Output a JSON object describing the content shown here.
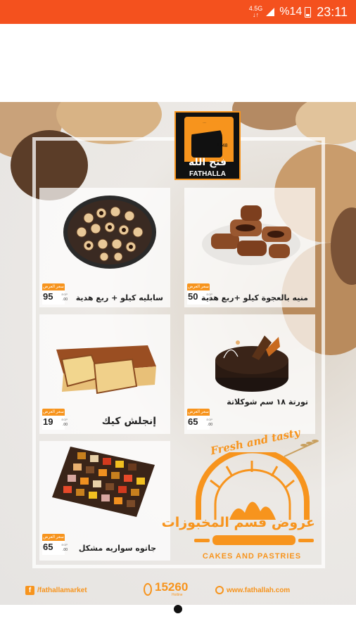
{
  "status_bar": {
    "network_top": "4.5G",
    "network_bottom": "↓↑",
    "battery_text": "%14",
    "time": "23:11"
  },
  "logo": {
    "year": "1948",
    "name_ar": "فتح الله",
    "name_en": "FATHALLA"
  },
  "products": [
    {
      "name": "منيه بالعجوة كيلو +ربع هدية",
      "price_label": "سعر العرض",
      "price": "50",
      "decimals": ".00",
      "currency": "EGP"
    },
    {
      "name": "سابليه كيلو + ربع هدية",
      "price_label": "سعر العرض",
      "price": "95",
      "decimals": ".00",
      "currency": "EGP"
    },
    {
      "name": "تورتة ١٨ سم شوكلاتة",
      "price_label": "سعر العرض",
      "price": "65",
      "decimals": ".00",
      "currency": "EGP"
    },
    {
      "name": "إنجلش كيك",
      "price_label": "سعر العرض",
      "price": "19",
      "decimals": ".00",
      "currency": "EGP"
    },
    {
      "name": "جاتوه سواريه مشكل",
      "price_label": "سعر العرض",
      "price": "65",
      "decimals": ".00",
      "currency": "EGP"
    }
  ],
  "bakery_banner": {
    "tagline": "Fresh and tasty",
    "title_ar": "عروض قسم المخبوزات",
    "subtitle_en": "CAKES AND PASTRIES"
  },
  "footer": {
    "facebook_icon_glyph": "f",
    "facebook": "/fathallamarket",
    "hotline_number": "15260",
    "hotline_label": "Hotline",
    "website": "www.fathallah.com"
  },
  "colors": {
    "status_bar": "#f4511e",
    "brand_orange": "#f7941d"
  }
}
